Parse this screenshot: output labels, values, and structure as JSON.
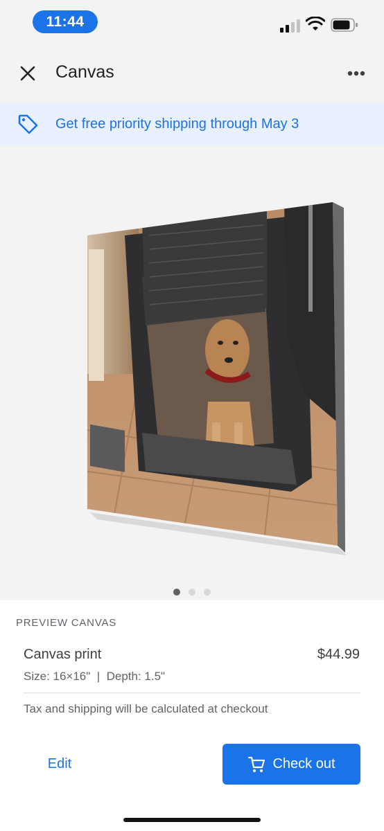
{
  "status_bar": {
    "time": "11:44",
    "icons": [
      "cellular-signal-icon",
      "wifi-icon",
      "battery-icon"
    ]
  },
  "app_bar": {
    "title": "Canvas",
    "close_icon": "close-icon",
    "more_icon": "more-horizontal-icon"
  },
  "promo": {
    "icon": "tag-icon",
    "text": "Get free priority shipping through May 3"
  },
  "preview": {
    "image": "dog-in-crate-canvas",
    "page_count": 3,
    "current_page": 1
  },
  "details": {
    "section_label": "PREVIEW CANVAS",
    "product_name": "Canvas print",
    "price": "$44.99",
    "specs": "Size: 16×16\"  |  Depth: 1.5\"",
    "tax_note": "Tax and shipping will be calculated at checkout"
  },
  "actions": {
    "edit_label": "Edit",
    "checkout_label": "Check out",
    "checkout_icon": "cart-icon"
  },
  "colors": {
    "accent": "#1a73e8",
    "promo_bg": "#e8f0fe",
    "surface": "#f3f3f3"
  }
}
